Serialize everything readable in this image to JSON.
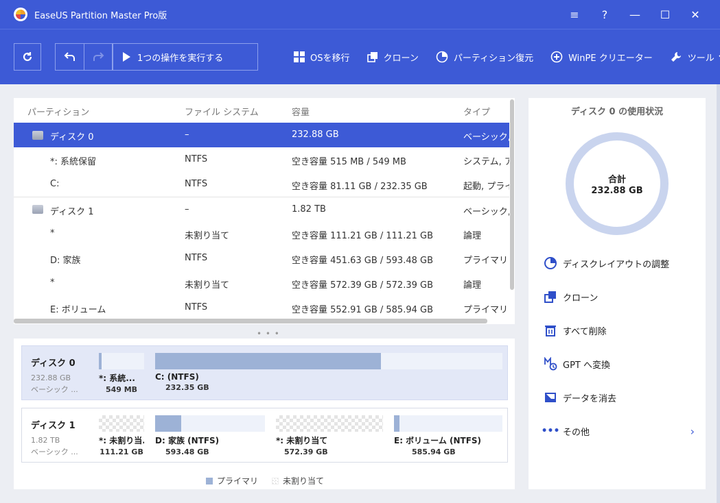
{
  "window": {
    "title": "EaseUS Partition Master Pro版",
    "controls": {
      "menu": "≡",
      "help": "?",
      "minimize": "—",
      "maximize": "☐",
      "close": "✕"
    }
  },
  "toolbar": {
    "execute_label": "1つの操作を実行する",
    "actions": [
      {
        "label": "OSを移行",
        "icon": "windows-icon"
      },
      {
        "label": "クローン",
        "icon": "clone-icon"
      },
      {
        "label": "パーティション復元",
        "icon": "pie-icon"
      },
      {
        "label": "WinPE クリエーター",
        "icon": "plus-circle-icon"
      },
      {
        "label": "ツール",
        "icon": "wrench-icon"
      }
    ]
  },
  "partition_list": {
    "columns": [
      "パーティション",
      "ファイル システム",
      "容量",
      "タイプ"
    ],
    "rows": [
      {
        "name": "ディスク 0",
        "fs": "–",
        "capacity": "232.88 GB",
        "type": "ベーシック, M",
        "is_disk": true,
        "selected": true
      },
      {
        "name": "*: 系統保留",
        "fs": "NTFS",
        "capacity": "空き容量 515 MB / 549 MB",
        "type": "システム, アク"
      },
      {
        "name": "C:",
        "fs": "NTFS",
        "capacity": "空き容量 81.11 GB / 232.35 GB",
        "type": "起動, プライ"
      },
      {
        "name": "ディスク 1",
        "fs": "–",
        "capacity": "1.82 TB",
        "type": "ベーシック, M",
        "is_disk": true
      },
      {
        "name": "*",
        "fs": "未割り当て",
        "capacity": "空き容量 111.21 GB / 111.21 GB",
        "type": "論理"
      },
      {
        "name": "D: 家族",
        "fs": "NTFS",
        "capacity": "空き容量 451.63 GB / 593.48 GB",
        "type": "プライマリ"
      },
      {
        "name": "*",
        "fs": "未割り当て",
        "capacity": "空き容量 572.39 GB / 572.39 GB",
        "type": "論理"
      },
      {
        "name": "E: ボリューム",
        "fs": "NTFS",
        "capacity": "空き容量 552.91 GB / 585.94 GB",
        "type": "プライマリ"
      }
    ]
  },
  "disk_map": {
    "disks": [
      {
        "name": "ディスク 0",
        "size": "232.88 GB",
        "type": "ベーシック ...",
        "partitions": [
          {
            "label": "*: 系統...",
            "size": "549 MB",
            "used_fraction": 0.06,
            "kind": "primary"
          },
          {
            "label": "C: (NTFS)",
            "size": "232.35 GB",
            "used_fraction": 0.65,
            "kind": "primary"
          }
        ]
      },
      {
        "name": "ディスク 1",
        "size": "1.82 TB",
        "type": "ベーシック ...",
        "partitions": [
          {
            "label": "*: 未割り当...",
            "size": "111.21 GB",
            "used_fraction": 0,
            "kind": "unallocated"
          },
          {
            "label": "D: 家族 (NTFS)",
            "size": "593.48 GB",
            "used_fraction": 0.24,
            "kind": "primary"
          },
          {
            "label": "*: 未割り当て",
            "size": "572.39 GB",
            "used_fraction": 0,
            "kind": "unallocated"
          },
          {
            "label": "E: ボリューム (NTFS)",
            "size": "585.94 GB",
            "used_fraction": 0.05,
            "kind": "primary"
          }
        ]
      }
    ],
    "legend": {
      "primary": "プライマリ",
      "unallocated": "未割り当て"
    }
  },
  "usage": {
    "title": "ディスク 0 の使用状況",
    "total_label": "合計",
    "total_value": "232.88 GB"
  },
  "operations": [
    {
      "label": "ディスクレイアウトの調整",
      "icon": "pie-icon"
    },
    {
      "label": "クローン",
      "icon": "clone-icon"
    },
    {
      "label": "すべて削除",
      "icon": "trash-icon"
    },
    {
      "label": "GPT へ変換",
      "icon": "convert-icon"
    },
    {
      "label": "データを消去",
      "icon": "eraser-icon"
    },
    {
      "label": "その他",
      "icon": "more-icon"
    }
  ],
  "colors": {
    "accent": "#3d5ad6",
    "primary_fill": "#9db2d6",
    "donut": "#c9d4ee"
  }
}
